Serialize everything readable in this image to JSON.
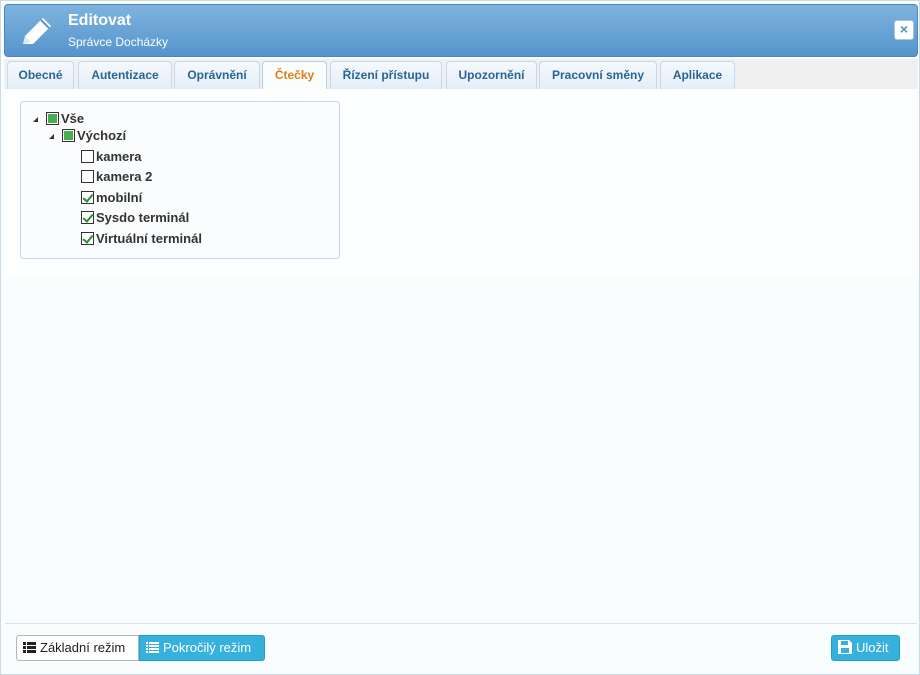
{
  "header": {
    "title": "Editovat",
    "subtitle": "Správce Docházky",
    "close_label": "×"
  },
  "tabs": [
    {
      "label": "Obecné",
      "active": false
    },
    {
      "label": "Autentizace",
      "active": false
    },
    {
      "label": "Oprávnění",
      "active": false
    },
    {
      "label": "Čtečky",
      "active": true
    },
    {
      "label": "Řízení přístupu",
      "active": false
    },
    {
      "label": "Upozornění",
      "active": false
    },
    {
      "label": "Pracovní směny",
      "active": false
    },
    {
      "label": "Aplikace",
      "active": false
    }
  ],
  "tree": {
    "root": {
      "label": "Vše",
      "state": "partial"
    },
    "group": {
      "label": "Výchozí",
      "state": "partial"
    },
    "items": [
      {
        "label": "kamera",
        "checked": false
      },
      {
        "label": "kamera 2",
        "checked": false
      },
      {
        "label": "mobilní",
        "checked": true
      },
      {
        "label": "Sysdo terminál",
        "checked": true
      },
      {
        "label": "Virtuální terminál",
        "checked": true
      }
    ]
  },
  "footer": {
    "basic_mode_label": "Základní režim",
    "advanced_mode_label": "Pokročilý režim",
    "save_label": "Uložit"
  },
  "colors": {
    "header": "#5595cc",
    "active_tab_text": "#e07d10",
    "tab_text": "#2a6496",
    "button_accent": "#36b1de",
    "checkbox_fill": "#46b04e"
  },
  "icons": {
    "header": "pencil-icon",
    "close": "close-icon",
    "basic_mode": "list-icon",
    "advanced_mode": "list-icon",
    "save": "floppy-icon"
  }
}
